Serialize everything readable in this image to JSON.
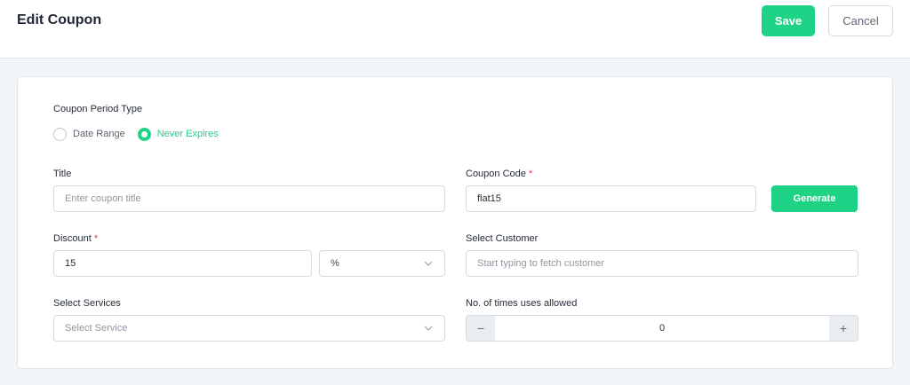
{
  "header": {
    "title": "Edit Coupon",
    "save_label": "Save",
    "cancel_label": "Cancel"
  },
  "form": {
    "period_type": {
      "label": "Coupon Period Type",
      "options": [
        "Date Range",
        "Never Expires"
      ],
      "selected": "Never Expires"
    },
    "title": {
      "label": "Title",
      "value": "",
      "placeholder": "Enter coupon title"
    },
    "coupon_code": {
      "label": "Coupon Code",
      "required_mark": "*",
      "value": "flat15",
      "generate_label": "Generate"
    },
    "discount": {
      "label": "Discount",
      "required_mark": "*",
      "value": "15",
      "type_value": "%"
    },
    "customer": {
      "label": "Select Customer",
      "value": "",
      "placeholder": "Start typing to fetch customer"
    },
    "services": {
      "label": "Select Services",
      "placeholder": "Select Service"
    },
    "uses": {
      "label": "No. of times uses allowed",
      "value": "0",
      "decrement_label": "−",
      "increment_label": "+"
    }
  },
  "colors": {
    "accent": "#1ed286",
    "required": "#e8344e",
    "page_bg": "#f1f5f8",
    "border": "#d6dbe1"
  },
  "icons": {
    "select_chevron": "chevron-down-icon"
  }
}
